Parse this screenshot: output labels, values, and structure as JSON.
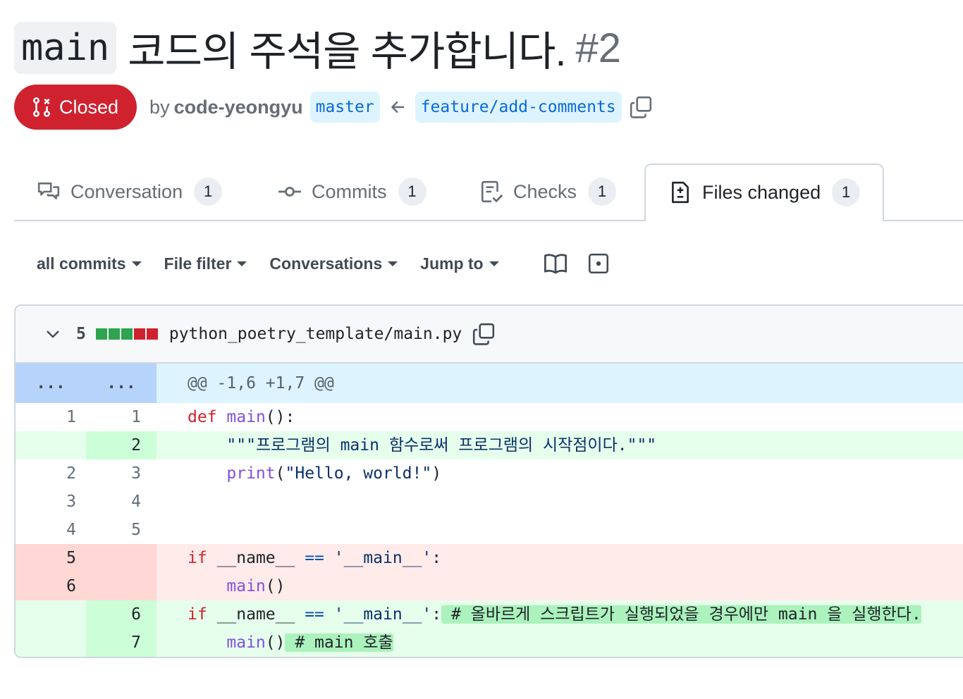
{
  "pr": {
    "title_code": "main",
    "title_text": "코드의 주석을 추가합니다.",
    "number": "#2",
    "state": "Closed",
    "by_label": "by",
    "author": "code-yeongyu",
    "base_branch": "master",
    "head_branch": "feature/add-comments"
  },
  "tabs": [
    {
      "label": "Conversation",
      "count": "1",
      "icon": "comment-discussion-icon"
    },
    {
      "label": "Commits",
      "count": "1",
      "icon": "git-commit-icon"
    },
    {
      "label": "Checks",
      "count": "1",
      "icon": "checklist-icon"
    },
    {
      "label": "Files changed",
      "count": "1",
      "icon": "file-diff-icon",
      "active": true
    }
  ],
  "toolbar": {
    "all_commits": "all commits",
    "file_filter": "File filter",
    "conversations": "Conversations",
    "jump_to": "Jump to"
  },
  "file": {
    "change_count": "5",
    "path": "python_poetry_template/main.py",
    "diffstat_colors": [
      "#2da44e",
      "#2da44e",
      "#2da44e",
      "#cf222e",
      "#cf222e"
    ],
    "hunk": {
      "left": "...",
      "right": "...",
      "header": "@@ -1,6 +1,7 @@"
    },
    "lines": {
      "l1": {
        "old": "1",
        "new": "1"
      },
      "l2": {
        "new": "2",
        "doc_open": "\"\"\"",
        "doc_text": "프로그램의 main 함수로써 프로그램의 시작점이다.",
        "doc_close": "\"\"\""
      },
      "l3": {
        "old": "2",
        "new": "3",
        "string": "\"Hello, world!\""
      },
      "l4": {
        "old": "3",
        "new": "4"
      },
      "l5": {
        "old": "4",
        "new": "5"
      },
      "l6": {
        "old": "5"
      },
      "l7": {
        "old": "6"
      },
      "l8": {
        "new": "6",
        "comment": "# 올바르게 스크립트가 실행되었을 경우에만 main 을 실행한다."
      },
      "l9": {
        "new": "7",
        "comment": "# main 호출"
      }
    },
    "tokens": {
      "def": "def",
      "main": "main",
      "parens_colon": "():",
      "print": "print",
      "if": "if",
      "dunder_name": "__name__",
      "eq": "==",
      "main_str": "'__main__'",
      "colon": ":",
      "call": "main",
      "call_parens": "()",
      "lparen": "(",
      "rparen": ")"
    }
  }
}
